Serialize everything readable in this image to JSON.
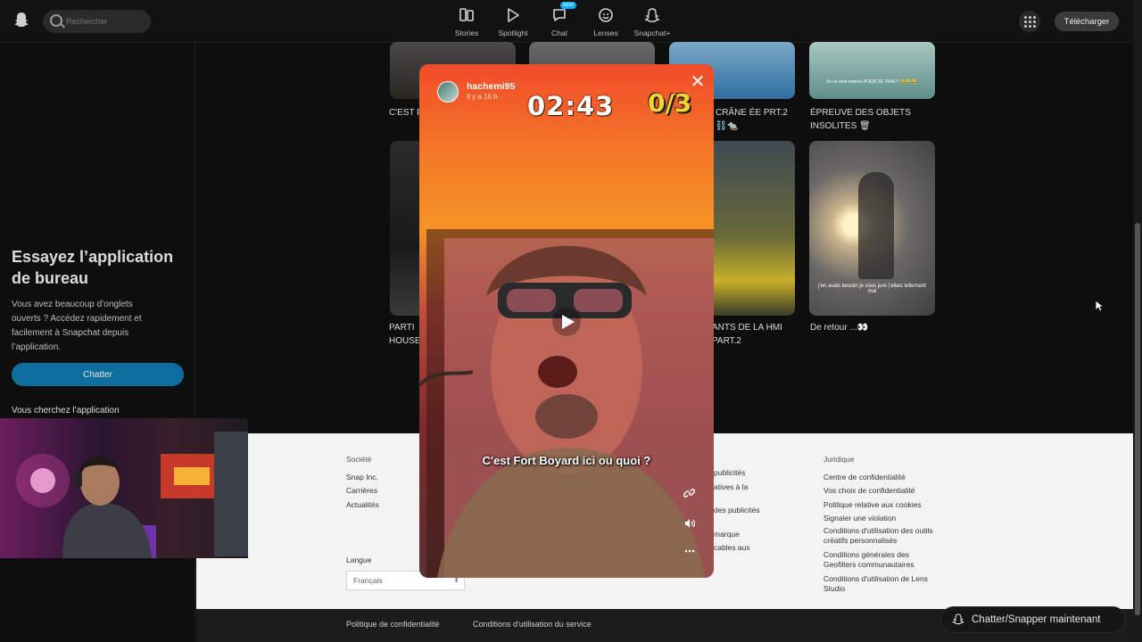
{
  "header": {
    "search_placeholder": "Rechercher",
    "nav": [
      {
        "label": "Stories",
        "icon": "stories-icon"
      },
      {
        "label": "Spotlight",
        "icon": "spotlight-icon"
      },
      {
        "label": "Chat",
        "icon": "chat-icon",
        "badge": "NEW"
      },
      {
        "label": "Lenses",
        "icon": "lenses-icon"
      },
      {
        "label": "Snapchat+",
        "icon": "snapchat-plus-icon"
      }
    ],
    "download_label": "Télécharger"
  },
  "sidebar": {
    "promo_title": "Essayez l’application de bureau",
    "promo_desc": "Vous avez beaucoup d’onglets ouverts ? Accédez rapidement et facilement à Snapchat depuis l’application.",
    "chat_button": "Chatter",
    "looking": "Vous cherchez l’application"
  },
  "grid": {
    "captions": [
      "C'EST F",
      "CRÂNE ÉE PRT.2 ⛓️🐀",
      "ÉPREUVE DES OBJETS INSOLITES 🗑",
      "PARTI HOUSE",
      "ANTS DE LA HMI PART.2",
      "De retour ...👀"
    ],
    "tile_text_1": "ils se sont marrés POUR DE VRAI !! 😂😂😂",
    "tile_text_2": "j’en avais besoin je vous jure j’allais tellement mal"
  },
  "story": {
    "username": "hachemi95",
    "time_ago": "Il y a 16 h",
    "timer": "02:43",
    "score": "0/3",
    "subtitle": "C'est Fort Boyard ici ou quoi ?"
  },
  "footer": {
    "col1": {
      "head": "Société",
      "items": [
        "Snap Inc.",
        "Carrières",
        "Actualités"
      ]
    },
    "col2_items": [
      "publicités",
      "atives à la",
      "",
      "des publicités",
      "",
      "marque",
      "cables aux"
    ],
    "col3": {
      "head": "Juridique",
      "items": [
        "Centre de confidentialité",
        "Vos choix de confidentialité",
        "Politique relative aux cookies",
        "Signaler une violation",
        "Conditions d'utilisation des outils créatifs personnalisés",
        "Conditions générales des Geofilters communautaires",
        "Conditions d'utilisation de Lens Studio"
      ]
    },
    "language_label": "Langue",
    "language_value": "Français",
    "bottom_links": [
      "Politique de confidentialité",
      "Conditions d'utilisation du service"
    ],
    "cta": "Chatter/Snapper maintenant"
  }
}
